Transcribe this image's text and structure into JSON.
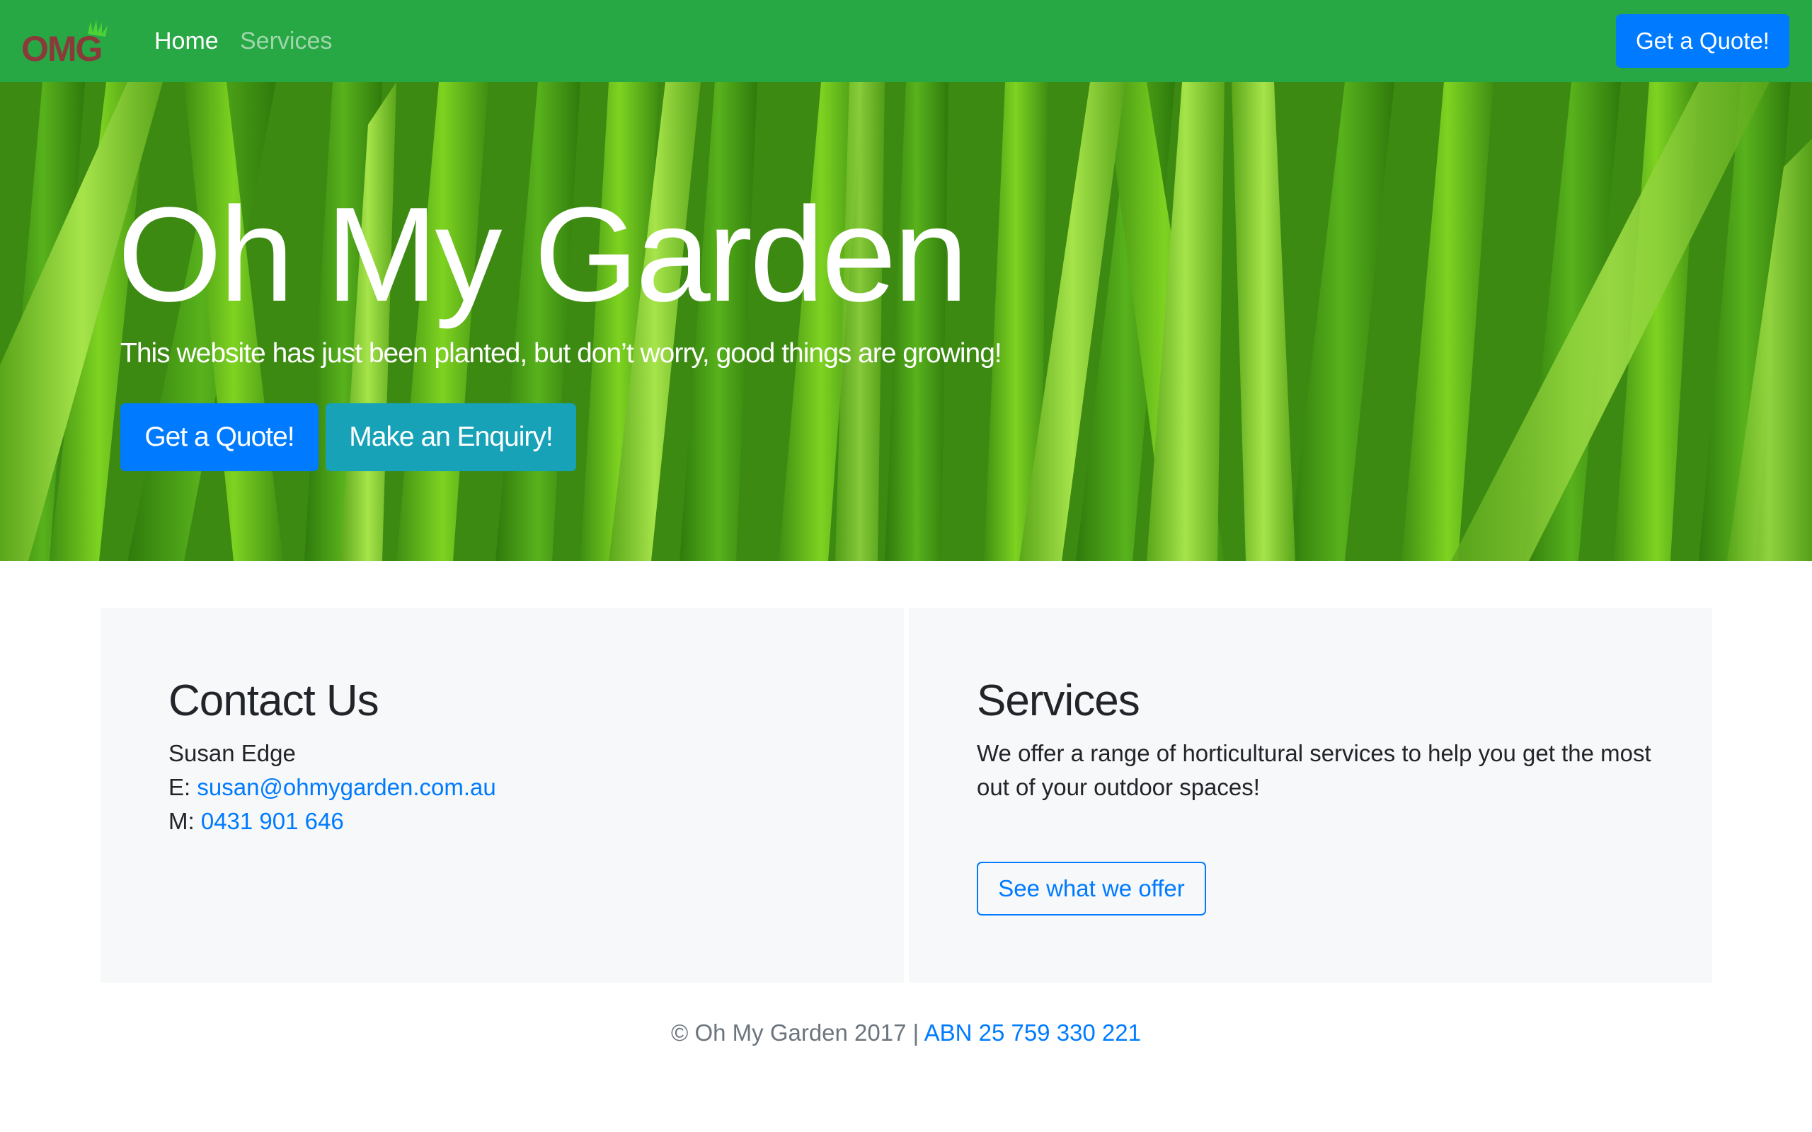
{
  "colors": {
    "navbar": "#28a745",
    "primary": "#007bff",
    "info": "#17a2b8",
    "card_bg": "#f7f8f9",
    "logo_text": "#8a3a3a"
  },
  "navbar": {
    "logo_text": "OMG",
    "links": [
      {
        "label": "Home",
        "active": true
      },
      {
        "label": "Services",
        "active": false
      }
    ],
    "cta_label": "Get a Quote!"
  },
  "hero": {
    "title": "Oh My Garden",
    "subtitle": "This website has just been planted, but don’t worry, good things are growing!",
    "buttons": [
      {
        "label": "Get a Quote!"
      },
      {
        "label": "Make an Enquiry!"
      }
    ]
  },
  "contact": {
    "heading": "Contact Us",
    "name": "Susan Edge",
    "email_prefix": "E:",
    "email": "susan@ohmygarden.com.au",
    "mobile_prefix": "M:",
    "mobile": "0431 901 646"
  },
  "services": {
    "heading": "Services",
    "text": "We offer a range of horticultural services to help you get the most out of your outdoor spaces!",
    "button_label": "See what we offer"
  },
  "footer": {
    "copyright": "© Oh My Garden 2017 |",
    "abn": "ABN 25 759 330 221"
  }
}
